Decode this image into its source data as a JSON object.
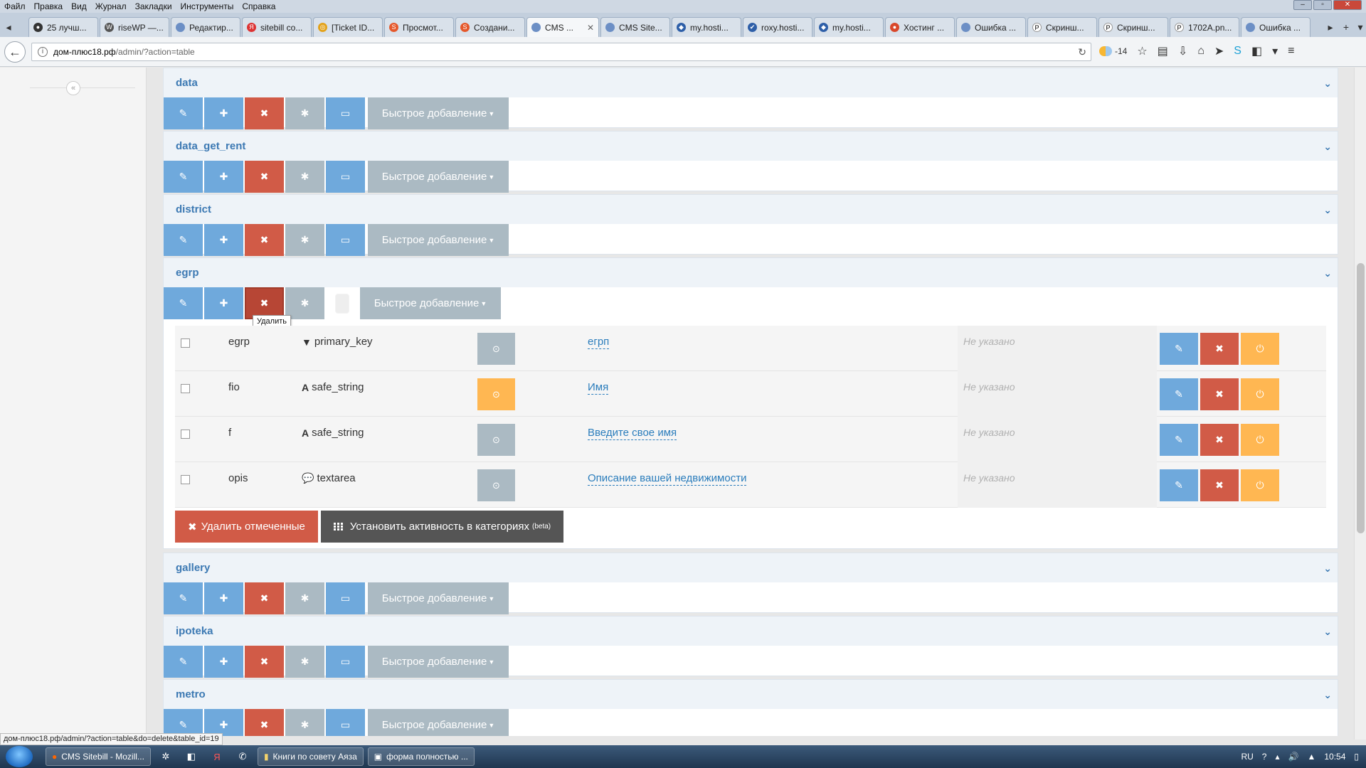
{
  "menu": [
    "Файл",
    "Правка",
    "Вид",
    "Журнал",
    "Закладки",
    "Инструменты",
    "Справка"
  ],
  "tabs": [
    {
      "label": "25 лучш...",
      "icon": "github-icon"
    },
    {
      "label": "riseWP —...",
      "icon": "wordpress-icon"
    },
    {
      "label": "Редактир...",
      "icon": "globe-icon"
    },
    {
      "label": "sitebill co...",
      "icon": "yandex-icon"
    },
    {
      "label": "[Ticket ID...",
      "icon": "ticket-icon"
    },
    {
      "label": "Просмот...",
      "icon": "s-icon"
    },
    {
      "label": "Создани...",
      "icon": "s-icon"
    },
    {
      "label": "CMS ...",
      "icon": "globe-icon",
      "active": true
    },
    {
      "label": "CMS Site...",
      "icon": "globe-icon"
    },
    {
      "label": "my.hosti...",
      "icon": "hosting-icon"
    },
    {
      "label": "roxy.hosti...",
      "icon": "hosting-icon"
    },
    {
      "label": "my.hosti...",
      "icon": "hosting-icon"
    },
    {
      "label": "Хостинг ...",
      "icon": "hosting-icon"
    },
    {
      "label": "Ошибка ...",
      "icon": "globe-icon"
    },
    {
      "label": "Скринш...",
      "icon": "p-icon"
    },
    {
      "label": "Скринш...",
      "icon": "p-icon"
    },
    {
      "label": "1702A.pn...",
      "icon": "p-icon"
    },
    {
      "label": "Ошибка ...",
      "icon": "globe-icon"
    }
  ],
  "url": {
    "host": "дом-плюс18.рф",
    "path": "/admin/?action=table"
  },
  "weather": "-14",
  "panels": {
    "data": "data",
    "data_get_rent": "data_get_rent",
    "district": "district",
    "egrp": "egrp",
    "gallery": "gallery",
    "ipoteka": "ipoteka",
    "metro": "metro"
  },
  "quick_add_label": "Быстрое добавление",
  "tooltip": "Удалить",
  "fields": [
    {
      "name": "egrp",
      "type": "primary_key",
      "type_icon": "filter-icon",
      "state": "gray",
      "title": "егрп",
      "hint": "Не указано"
    },
    {
      "name": "fio",
      "type": "safe_string",
      "type_icon": "font-icon",
      "state": "orange",
      "title": "Имя",
      "hint": "Не указано"
    },
    {
      "name": "f",
      "type": "safe_string",
      "type_icon": "font-icon",
      "state": "gray",
      "title": "Введите свое имя",
      "hint": "Не указано"
    },
    {
      "name": "opis",
      "type": "textarea",
      "type_icon": "comment-icon",
      "state": "gray",
      "title": "Описание вашей недвижимости",
      "hint": "Не указано"
    }
  ],
  "bulk": {
    "delete_label": "Удалить отмеченные",
    "activity_label": "Установить активность в категориях",
    "beta": "(beta)"
  },
  "status_url": "дом-плюс18.рф/admin/?action=table&do=delete&table_id=19",
  "taskbar": {
    "items": [
      "CMS Sitebill - Mozill...",
      "Книги по совету Аяза",
      "форма полностью ..."
    ],
    "lang": "RU",
    "time": "10:54"
  },
  "colors": {
    "blue": "#6fa9dc",
    "red": "#d15b47",
    "gray": "#abbac3",
    "orange": "#ffb752",
    "link": "#2b7dbc"
  }
}
